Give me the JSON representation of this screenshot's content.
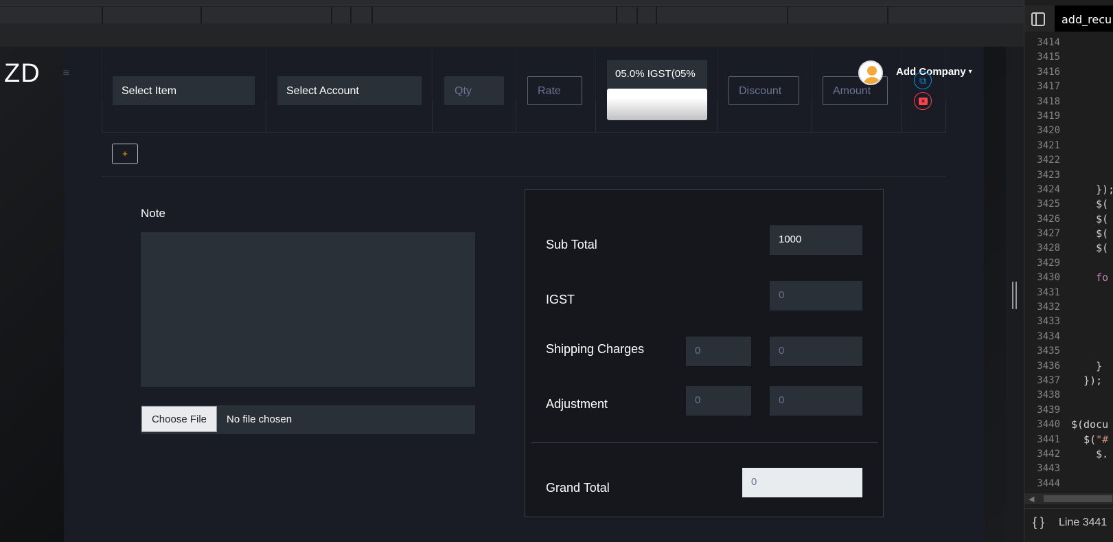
{
  "app": {
    "brand": "ZD",
    "menu_icon": "hamburger-icon"
  },
  "item_row": {
    "select_item": "Select Item",
    "select_account": "Select Account",
    "qty_placeholder": "Qty",
    "rate_placeholder": "Rate",
    "tax_value": "05.0% IGST(05%",
    "discount_placeholder": "Discount",
    "amount_placeholder": "Amount",
    "add_row_label": "+"
  },
  "header": {
    "company_label": "Add Company",
    "caret": "▾"
  },
  "note": {
    "label": "Note",
    "choose_file": "Choose File",
    "file_status": "No file chosen"
  },
  "totals": {
    "sub_total_label": "Sub Total",
    "sub_total_value": "1000",
    "igst_label": "IGST",
    "igst_value": "0",
    "shipping_label": "Shipping Charges",
    "shipping_value_1": "0",
    "shipping_value_2": "0",
    "adjustment_label": "Adjustment",
    "adjustment_value_1": "0",
    "adjustment_value_2": "0",
    "grand_total_label": "Grand Total",
    "grand_total_value": "0"
  },
  "editor": {
    "tab_title": "add_recu",
    "line_numbers": [
      "3414",
      "3415",
      "3416",
      "3417",
      "3418",
      "3419",
      "3420",
      "3421",
      "3422",
      "3423",
      "3424",
      "3425",
      "3426",
      "3427",
      "3428",
      "3429",
      "3430",
      "3431",
      "3432",
      "3433",
      "3434",
      "3435",
      "3436",
      "3437",
      "3438",
      "3439",
      "3440",
      "3441",
      "3442",
      "3443",
      "3444"
    ],
    "status_line": "Line 3441",
    "status_icon": "braces-icon"
  },
  "colors": {
    "card_bg": "#191c24",
    "input_bg": "#2a3038",
    "accent_warning": "#ffab00",
    "accent_info": "#0090e7",
    "accent_danger": "#fc424a"
  }
}
